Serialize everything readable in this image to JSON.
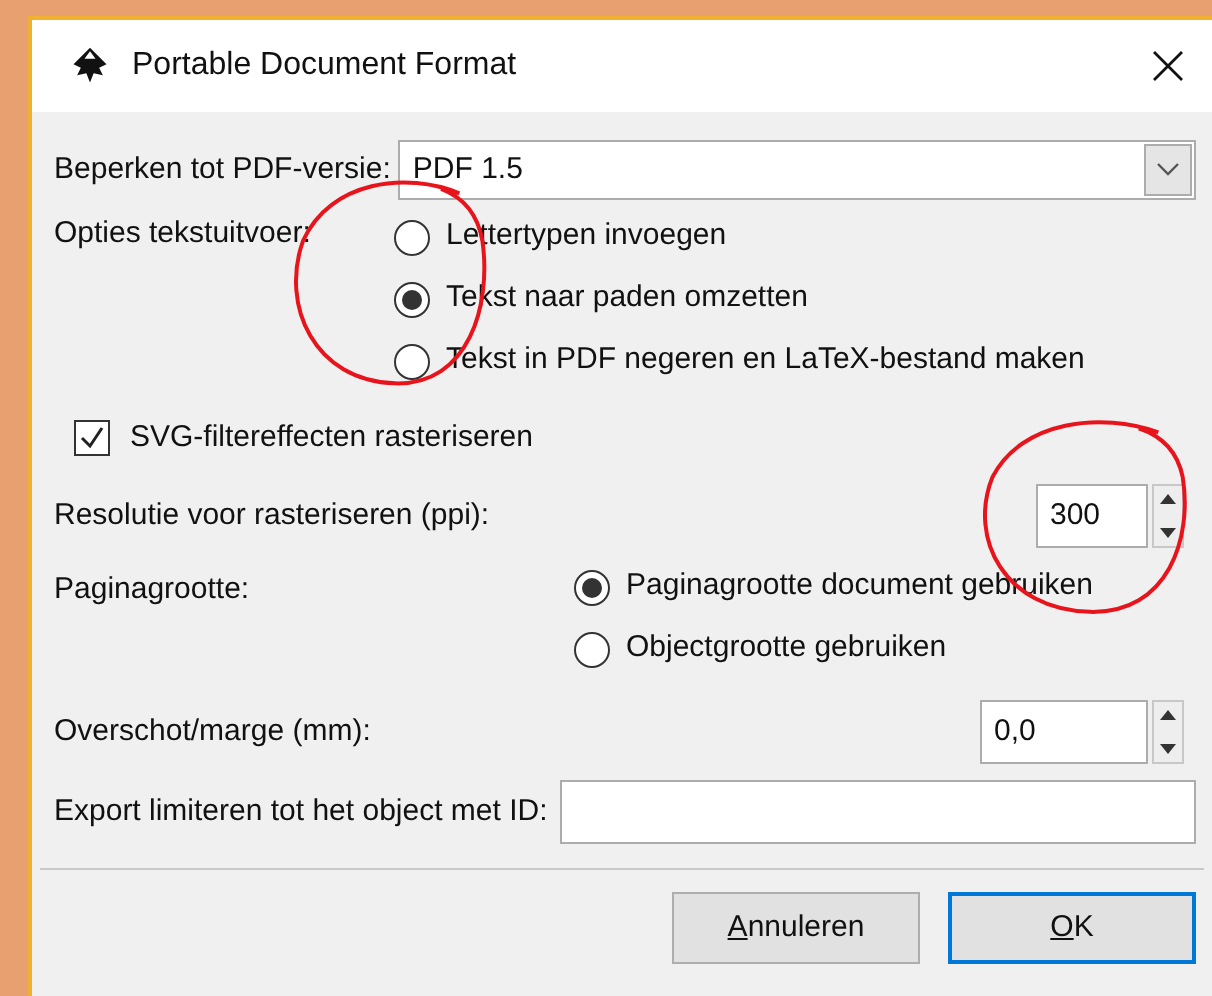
{
  "window": {
    "title": "Portable Document Format"
  },
  "pdf_version": {
    "label": "Beperken tot PDF-versie:",
    "value": "PDF 1.5"
  },
  "text_output": {
    "label": "Opties tekstuitvoer:",
    "options": [
      {
        "label": "Lettertypen invoegen",
        "selected": false
      },
      {
        "label": "Tekst naar paden omzetten",
        "selected": true
      },
      {
        "label": "Tekst in PDF negeren en LaTeX-bestand maken",
        "selected": false
      }
    ]
  },
  "rasterize_filters": {
    "label": "SVG-filtereffecten rasteriseren",
    "checked": true
  },
  "resolution": {
    "label": "Resolutie voor rasteriseren (ppi):",
    "value": "300"
  },
  "page_size": {
    "label": "Paginagrootte:",
    "options": [
      {
        "label": "Paginagrootte document gebruiken",
        "selected": true
      },
      {
        "label": "Objectgrootte gebruiken",
        "selected": false
      }
    ]
  },
  "bleed": {
    "label": "Overschot/marge (mm):",
    "value": "0,0"
  },
  "export_id": {
    "label": "Export limiteren tot het object met ID:"
  },
  "buttons": [
    {
      "label": "Annuleren",
      "default": false
    },
    {
      "label": "OK",
      "default": true
    }
  ],
  "annotations": [
    {
      "kind": "circle"
    },
    {
      "kind": "circle"
    }
  ]
}
